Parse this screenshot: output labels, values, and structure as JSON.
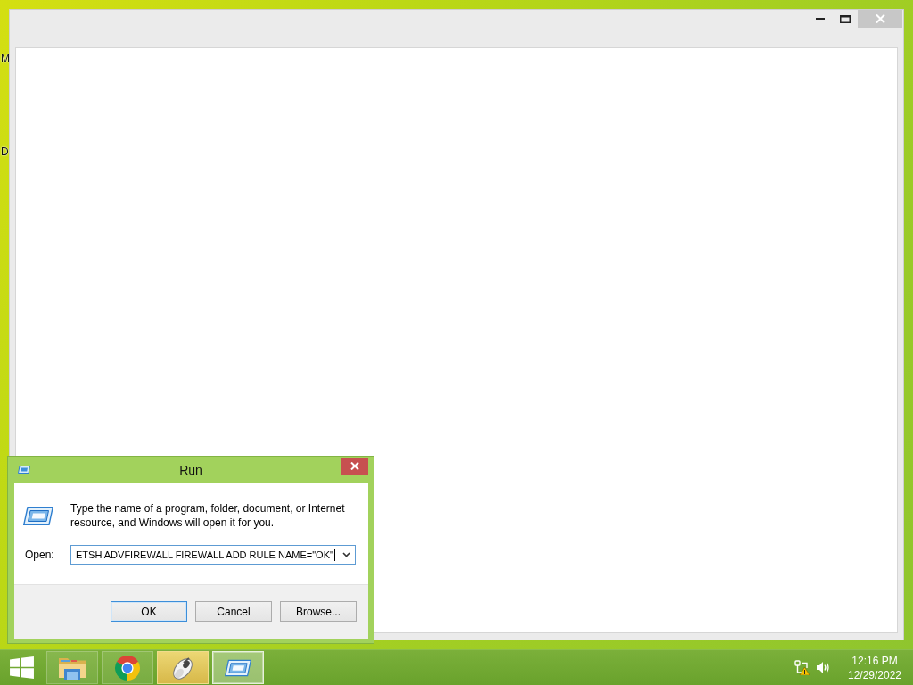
{
  "desktop": {
    "icon_labels": [
      "M",
      "D"
    ]
  },
  "run_dialog": {
    "title": "Run",
    "message": "Type the name of a program, folder, document, or Internet\nresource, and Windows will open it for you.",
    "open_label": "Open:",
    "command": "ETSH ADVFIREWALL FIREWALL ADD RULE NAME=\"OK\"",
    "buttons": [
      {
        "label": "OK",
        "default": true
      },
      {
        "label": "Cancel",
        "default": false
      },
      {
        "label": "Browse...",
        "default": false
      }
    ]
  },
  "taskbar": {
    "apps": [
      {
        "kind": "folder",
        "selected": false,
        "hovered": false
      },
      {
        "kind": "chrome",
        "selected": false,
        "hovered": false
      },
      {
        "kind": "mouse",
        "selected": false,
        "hovered": true
      },
      {
        "kind": "run",
        "selected": true,
        "hovered": false
      }
    ],
    "time": "12:16 PM",
    "date": "12/29/2022"
  }
}
